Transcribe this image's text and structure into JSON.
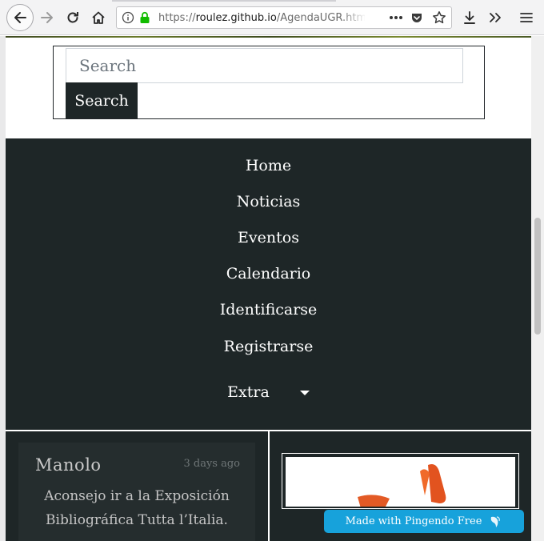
{
  "browser": {
    "url_prefix": "https://",
    "url_host": "roulez.github.io",
    "url_path": "/AgendaUGR.html",
    "icons": [
      "back-icon",
      "forward-icon",
      "reload-icon",
      "home-icon",
      "info-icon",
      "lock-icon",
      "page-actions-icon",
      "pocket-icon",
      "bookmark-star-icon",
      "download-icon",
      "overflow-icon",
      "menu-icon"
    ]
  },
  "search": {
    "placeholder": "Search",
    "button_label": "Search"
  },
  "nav": {
    "items": [
      "Home",
      "Noticias",
      "Eventos",
      "Calendario",
      "Identificarse",
      "Registrarse"
    ],
    "extra_label": "Extra"
  },
  "post": {
    "author": "Manolo",
    "time": "3 days ago",
    "text_line1": "Aconsejo ir a la Exposición",
    "text_line2": "Bibliográfica Tutta l’Italia."
  },
  "badge": {
    "label": "Made with Pingendo Free"
  },
  "colors": {
    "dark": "#1e2627",
    "accent": "#17a2db"
  }
}
